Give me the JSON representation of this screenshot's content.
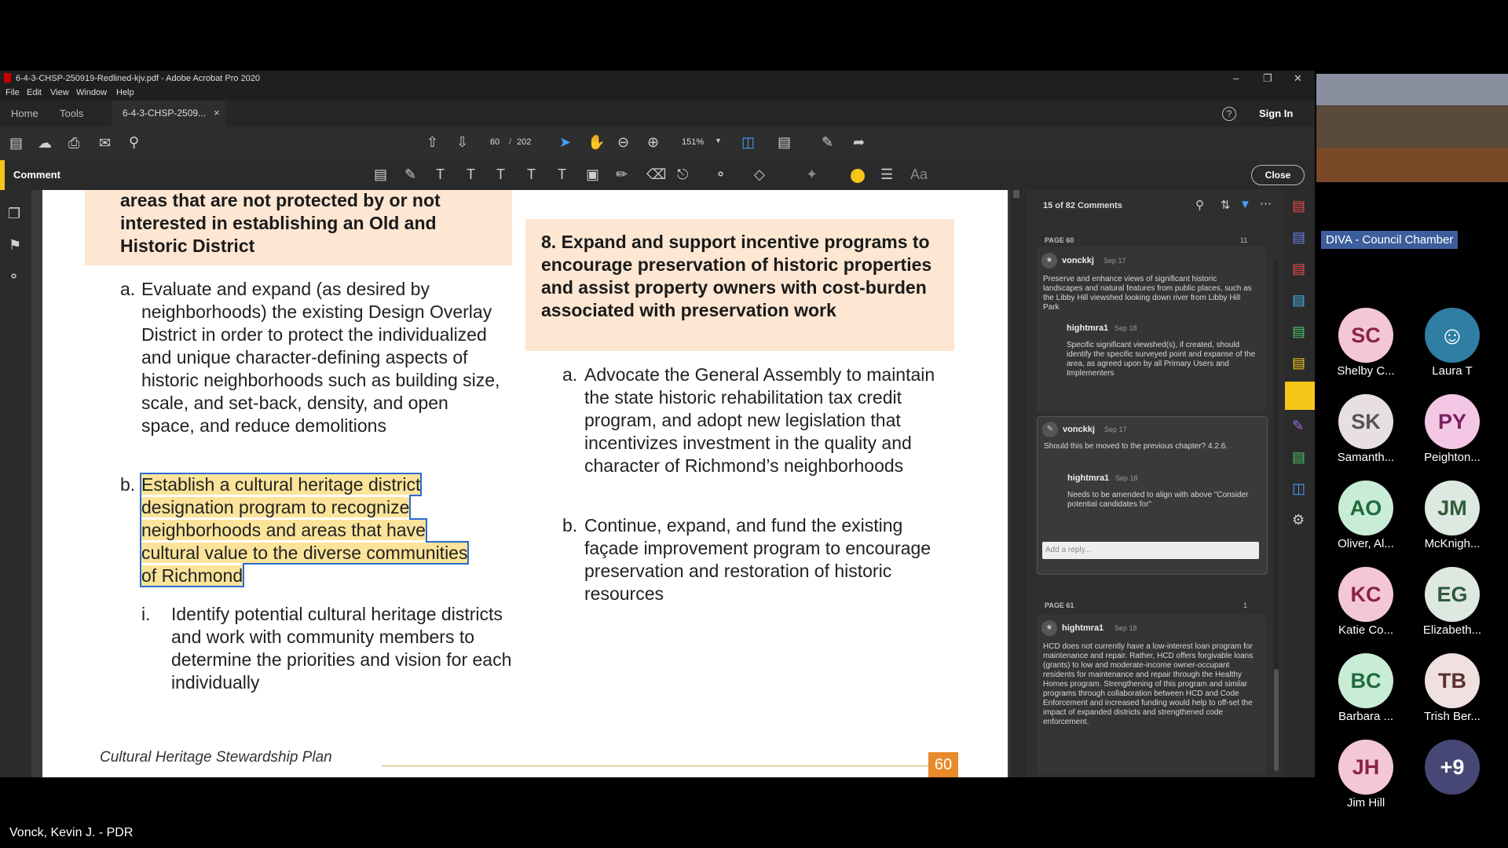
{
  "window": {
    "title": "6-4-3-CHSP-250919-Redlined-kjv.pdf - Adobe Acrobat Pro 2020",
    "menu": [
      "File",
      "Edit",
      "View",
      "Window",
      "Help"
    ],
    "tabs": {
      "home": "Home",
      "tools": "Tools",
      "doc": "6-4-3-CHSP-2509...",
      "close": "×"
    },
    "help_icon": "?",
    "sign_in": "Sign In"
  },
  "toolbar": {
    "page_current": "60",
    "page_sep": "/",
    "page_total": "202",
    "zoom": "151%"
  },
  "comment_bar": {
    "label": "Comment",
    "close_button": "Close",
    "accent": "#f5c518"
  },
  "document": {
    "left_header": "areas that are not protected by or not interested in establishing an Old and Historic District",
    "item_a_marker": "a.",
    "item_a": "Evaluate and expand (as desired by neighborhoods) the existing Design Overlay District in order to protect the individualized and unique character-defining aspects of historic neighborhoods such as building size, scale, and set-back, density, and open space, and reduce demolitions",
    "item_b_marker": "b.",
    "item_b": "Establish a cultural heritage district designation program to recognize neighborhoods and areas that have cultural value to the diverse communities of Richmond",
    "item_i_marker": "i.",
    "item_i": "Identify potential cultural heritage districts and work with community members to determine the priorities and vision for each individually",
    "right_header": "8. Expand and support incentive programs to encourage preservation of historic properties and assist property owners with cost-burden associated with preservation work",
    "r_item_a_marker": "a.",
    "r_item_a": "Advocate the General Assembly to maintain the state historic rehabilitation tax credit program, and adopt new legislation that incentivizes investment in the quality and character of Richmond’s neighborhoods",
    "r_item_b_marker": "b.",
    "r_item_b": "Continue, expand, and fund the existing façade improvement program to encourage preservation and restoration of historic resources",
    "footer_title": "Cultural Heritage Stewardship Plan",
    "page_number": "60"
  },
  "comments": {
    "count_label": "15 of 82 Comments",
    "page60": {
      "label": "PAGE 60",
      "count": "11"
    },
    "c1": {
      "author": "vonckkj",
      "date": "Sep 17",
      "text": "Preserve and enhance views of significant historic landscapes and natural features from public places, such as the Libby Hill viewshed looking down river from Libby Hill Park"
    },
    "c1r": {
      "author": "hightmra1",
      "date": "Sep 18",
      "text": "Specific significant viewshed(s), if created, should identify the specific surveyed point and expanse of the area, as agreed upon by all Primary Users and Implementers"
    },
    "c2": {
      "author": "vonckkj",
      "date": "Sep 17",
      "text": "Should this be moved to the previous chapter? 4.2.6."
    },
    "c2r": {
      "author": "hightmra1",
      "date": "Sep 18",
      "text": "Needs to be amended to align with above \"Consider potential candidates for\""
    },
    "reply_placeholder": "Add a reply...",
    "page61": {
      "label": "PAGE 61",
      "count": "1"
    },
    "c3": {
      "author": "hightmra1",
      "date": "Sep 18",
      "text": "HCD does not currently have a low-interest loan program for maintenance and repair. Rather, HCD offers forgivable loans (grants) to low and moderate-income owner-occupant residents for maintenance and repair through the Healthy Homes program. Strengthening of this program and similar programs through collaboration between HCD and Code Enforcement and increased funding would help to off-set the impact of expanded districts and strengthened code enforcement."
    }
  },
  "meeting": {
    "room_label": "DIVA - Council Chamber",
    "participants": [
      {
        "initials": "SC",
        "name": "Shelby C...",
        "bg": "#f4c7d4",
        "fg": "#8a2148"
      },
      {
        "initials": "",
        "name": "Laura T",
        "bg": "#2f7ea3",
        "fg": "#fff"
      },
      {
        "initials": "SK",
        "name": "Samanth...",
        "bg": "#e8e0e0",
        "fg": "#555"
      },
      {
        "initials": "PY",
        "name": "Peighton...",
        "bg": "#f4c7e4",
        "fg": "#7a2060"
      },
      {
        "initials": "AO",
        "name": "Oliver, Al...",
        "bg": "#c8ecd6",
        "fg": "#1f6b3d"
      },
      {
        "initials": "JM",
        "name": "McKnigh...",
        "bg": "#dde8e0",
        "fg": "#2f5a3b"
      },
      {
        "initials": "KC",
        "name": "Katie Co...",
        "bg": "#f4c7d4",
        "fg": "#8a2148"
      },
      {
        "initials": "EG",
        "name": "Elizabeth...",
        "bg": "#dde8e0",
        "fg": "#2f5a3b"
      },
      {
        "initials": "BC",
        "name": "Barbara ...",
        "bg": "#c8ecd6",
        "fg": "#1f6b3d"
      },
      {
        "initials": "TB",
        "name": "Trish Ber...",
        "bg": "#f0e0e0",
        "fg": "#5a3030"
      },
      {
        "initials": "JH",
        "name": "Jim Hill",
        "bg": "#f4c7d4",
        "fg": "#8a2148"
      },
      {
        "initials": "+9",
        "name": "",
        "bg": "#464775",
        "fg": "#fff"
      }
    ],
    "speaker": "Vonck, Kevin J. - PDR"
  }
}
